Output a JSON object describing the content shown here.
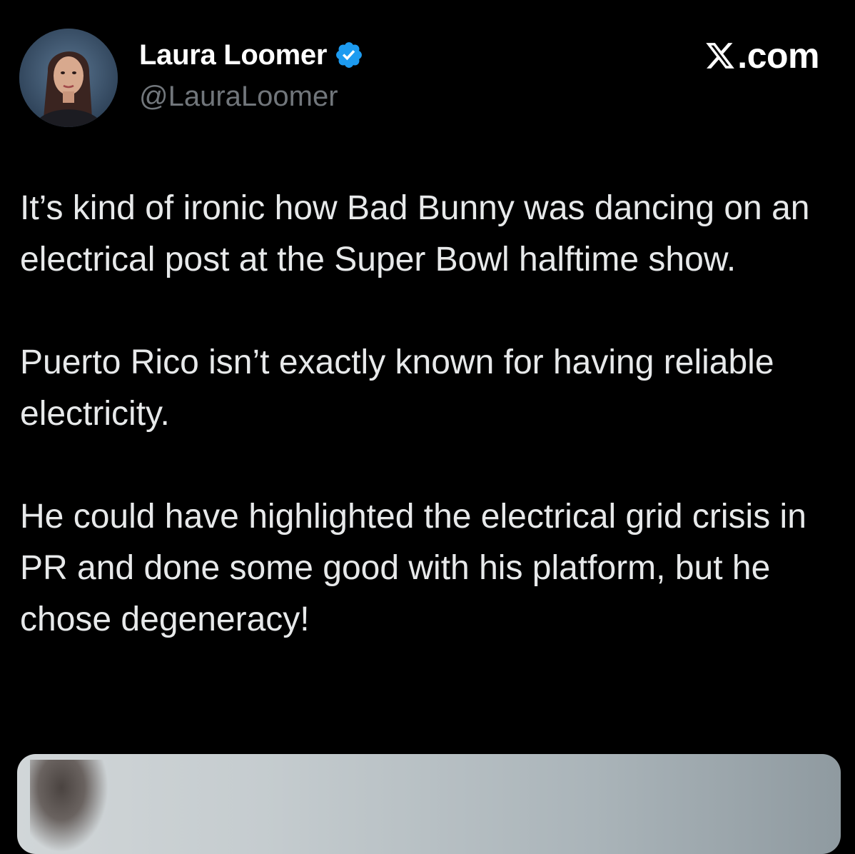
{
  "author": {
    "display_name": "Laura Loomer",
    "handle": "@LauraLoomer",
    "verified": true,
    "verified_icon": "verified-badge-icon",
    "verified_color": "#1d9bf0"
  },
  "brand": {
    "logo_icon": "x-logo-icon",
    "text": ".com"
  },
  "tweet": {
    "paragraphs": [
      "It’s kind of ironic how Bad Bunny was dancing on an electrical post at the Super Bowl halftime show.",
      "Puerto Rico isn’t exactly known for having reliable electricity.",
      "He could have highlighted the electrical grid crisis in PR and done some good with his platform, but he chose degeneracy!"
    ]
  },
  "colors": {
    "background": "#000000",
    "text": "#e7e9ea",
    "secondary_text": "#71767b"
  }
}
